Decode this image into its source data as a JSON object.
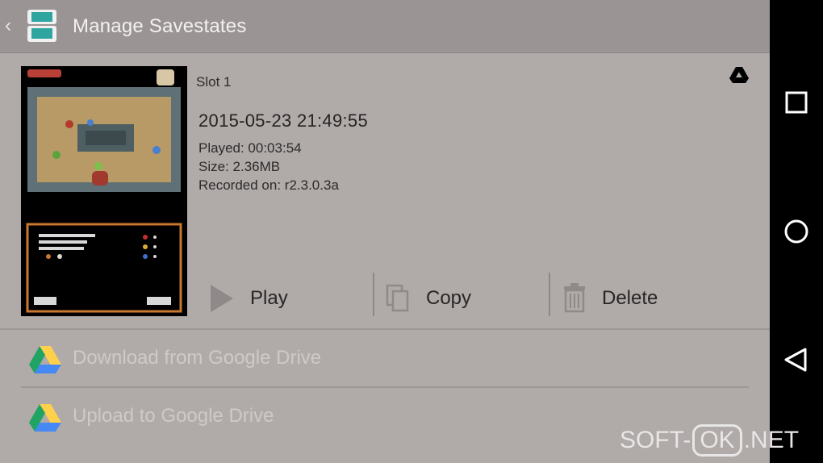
{
  "appbar": {
    "title": "Manage Savestates"
  },
  "savestate": {
    "slot": "Slot 1",
    "datetime": "2015-05-23 21:49:55",
    "played": "Played: 00:03:54",
    "size": "Size: 2.36MB",
    "recorded": "Recorded on: r2.3.0.3a",
    "actions": {
      "play": "Play",
      "copy": "Copy",
      "delete": "Delete"
    }
  },
  "drive": {
    "download": "Download from Google Drive",
    "upload": "Upload to Google Drive"
  },
  "watermark": {
    "left": "SOFT-",
    "box": "OK",
    "right": ".NET"
  },
  "colors": {
    "drive_green": "#1fa463",
    "drive_yellow": "#ffd04b",
    "drive_blue": "#4688f4"
  }
}
